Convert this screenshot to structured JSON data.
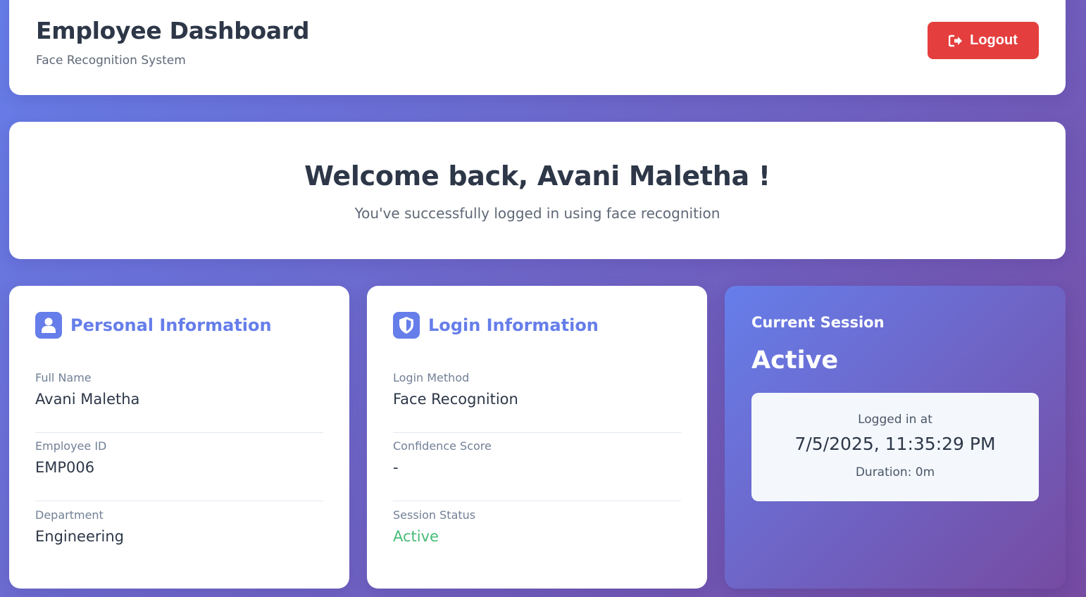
{
  "header": {
    "title": "Employee Dashboard",
    "subtitle": "Face Recognition System",
    "logout_label": "Logout",
    "logout_icon": "sign-out-icon",
    "logout_color": "#e53e3e"
  },
  "welcome": {
    "heading": "Welcome back, Avani Maletha !",
    "message": "You've successfully logged in using face recognition"
  },
  "personal_info": {
    "title": "Personal Information",
    "icon": "user-icon",
    "fields": [
      {
        "label": "Full Name",
        "value": "Avani Maletha"
      },
      {
        "label": "Employee ID",
        "value": "EMP006"
      },
      {
        "label": "Department",
        "value": "Engineering"
      }
    ]
  },
  "login_info": {
    "title": "Login Information",
    "icon": "shield-icon",
    "fields": [
      {
        "label": "Login Method",
        "value": "Face Recognition"
      },
      {
        "label": "Confidence Score",
        "value": "-"
      },
      {
        "label": "Session Status",
        "value": "Active"
      }
    ]
  },
  "session": {
    "title": "Current Session",
    "status": "Active",
    "logged_in_label": "Logged in at",
    "logged_in_time": "7/5/2025, 11:35:29 PM",
    "duration": "Duration: 0m"
  },
  "colors": {
    "accent": "#667eea",
    "gradient_end": "#764ba2",
    "active_green": "#48bb78"
  }
}
